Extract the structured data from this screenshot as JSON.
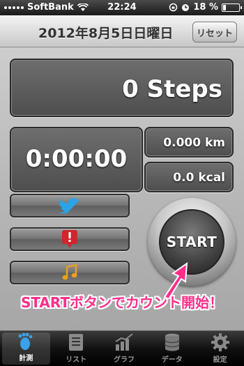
{
  "status_bar": {
    "carrier": "SoftBank",
    "time": "22:24",
    "battery": "18 %",
    "battery_level": 0.18
  },
  "header": {
    "date": "2012年8月5日日曜日",
    "reset_label": "リセット"
  },
  "stats": {
    "steps": "0 Steps",
    "elapsed": "0:00:00",
    "distance": "0.000 km",
    "calories": "0.0 kcal"
  },
  "buttons": [
    {
      "icon": "twitter-bird-icon",
      "color": "#2aa4e8"
    },
    {
      "icon": "alert-icon",
      "color": "#d0252c"
    },
    {
      "icon": "music-note-icon",
      "color": "#e8a020"
    }
  ],
  "start_label": "START",
  "caption": "STARTボタンでカウント開始！",
  "caption_color": "#ff2f8a",
  "tabs": [
    {
      "label": "計測",
      "icon": "footprint-icon",
      "active": true
    },
    {
      "label": "リスト",
      "icon": "list-icon",
      "active": false
    },
    {
      "label": "グラフ",
      "icon": "graph-icon",
      "active": false
    },
    {
      "label": "データ",
      "icon": "database-icon",
      "active": false
    },
    {
      "label": "設定",
      "icon": "gear-icon",
      "active": false
    }
  ]
}
